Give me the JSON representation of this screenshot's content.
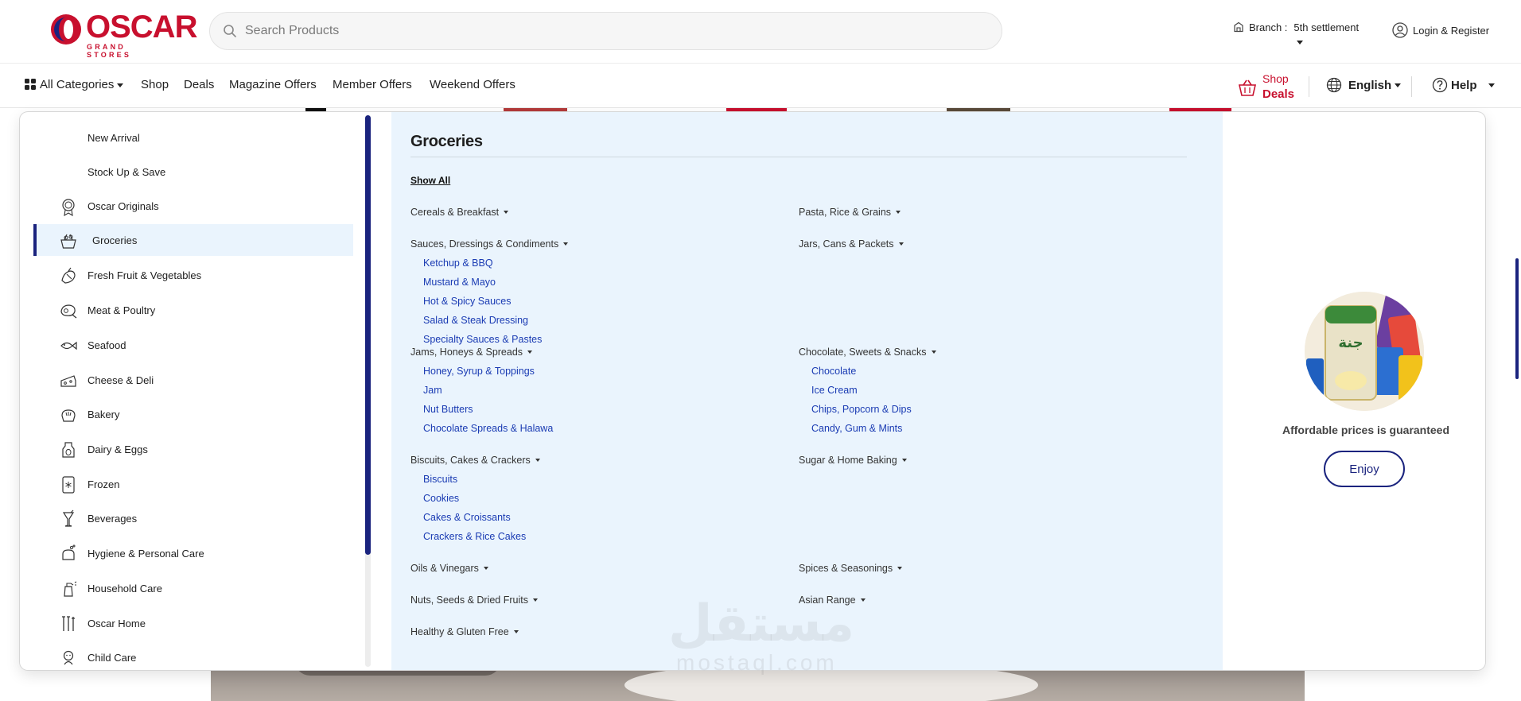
{
  "header": {
    "logo_text": "OSCAR",
    "logo_subtitle": "GRAND STORES",
    "search_placeholder": "Search Products",
    "branch_label": "Branch :",
    "branch_value": "5th settlement",
    "login_label": "Login & Register"
  },
  "nav": {
    "all_categories": "All Categories",
    "items": [
      "Shop",
      "Deals",
      "Magazine Offers",
      "Member Offers",
      "Weekend Offers"
    ],
    "shop_deals_line1": "Shop",
    "shop_deals_line2": "Deals",
    "language": "English",
    "help": "Help"
  },
  "categories": [
    {
      "label": "New Arrival",
      "icon": "none"
    },
    {
      "label": "Stock Up & Save",
      "icon": "none"
    },
    {
      "label": "Oscar Originals",
      "icon": "badge-icon"
    },
    {
      "label": "Groceries",
      "icon": "basket-icon",
      "active": true
    },
    {
      "label": "Fresh Fruit & Vegetables",
      "icon": "vegetables-icon"
    },
    {
      "label": "Meat & Poultry",
      "icon": "meat-icon"
    },
    {
      "label": "Seafood",
      "icon": "fish-icon"
    },
    {
      "label": "Cheese & Deli",
      "icon": "cheese-icon"
    },
    {
      "label": "Bakery",
      "icon": "bread-icon"
    },
    {
      "label": "Dairy & Eggs",
      "icon": "milk-icon"
    },
    {
      "label": "Frozen",
      "icon": "freezer-icon"
    },
    {
      "label": "Beverages",
      "icon": "drink-icon"
    },
    {
      "label": "Hygiene & Personal Care",
      "icon": "soap-icon"
    },
    {
      "label": "Household Care",
      "icon": "spray-icon"
    },
    {
      "label": "Oscar Home",
      "icon": "tools-icon"
    },
    {
      "label": "Child Care",
      "icon": "baby-icon"
    }
  ],
  "subpanel": {
    "title": "Groceries",
    "show_all": "Show All",
    "left_groups": [
      {
        "title": "Cereals & Breakfast",
        "items": []
      },
      {
        "title": "Sauces, Dressings & Condiments",
        "items": [
          "Ketchup & BBQ",
          "Mustard & Mayo",
          "Hot & Spicy Sauces",
          "Salad & Steak Dressing",
          "Specialty Sauces & Pastes"
        ]
      },
      {
        "title": "Jams, Honeys & Spreads",
        "items": [
          "Honey, Syrup & Toppings",
          "Jam",
          "Nut Butters",
          "Chocolate Spreads & Halawa"
        ]
      },
      {
        "title": "Biscuits, Cakes & Crackers",
        "items": [
          "Biscuits",
          "Cookies",
          "Cakes & Croissants",
          "Crackers & Rice Cakes"
        ]
      },
      {
        "title": "Oils & Vinegars",
        "items": []
      },
      {
        "title": "Nuts, Seeds & Dried Fruits",
        "items": []
      },
      {
        "title": "Healthy & Gluten Free",
        "items": []
      }
    ],
    "right_groups": [
      {
        "title": "Pasta, Rice & Grains",
        "items": []
      },
      {
        "title": "Jars, Cans & Packets",
        "items": []
      },
      {
        "title": "Chocolate, Sweets & Snacks",
        "items": [
          "Chocolate",
          "Ice Cream",
          "Chips, Popcorn & Dips",
          "Candy, Gum & Mints"
        ]
      },
      {
        "title": "Sugar & Home Baking",
        "items": []
      },
      {
        "title": "Spices & Seasonings",
        "items": []
      },
      {
        "title": "Asian Range",
        "items": []
      }
    ]
  },
  "promo": {
    "tagline": "Affordable prices is guaranteed",
    "button": "Enjoy"
  },
  "watermark": {
    "arabic": "مستقل",
    "latin": "mostaql.com"
  },
  "colors": {
    "brand_red": "#c8102e",
    "brand_navy": "#1a237e",
    "panel_bg": "#eaf4fd",
    "link_blue": "#1a3bb3"
  }
}
